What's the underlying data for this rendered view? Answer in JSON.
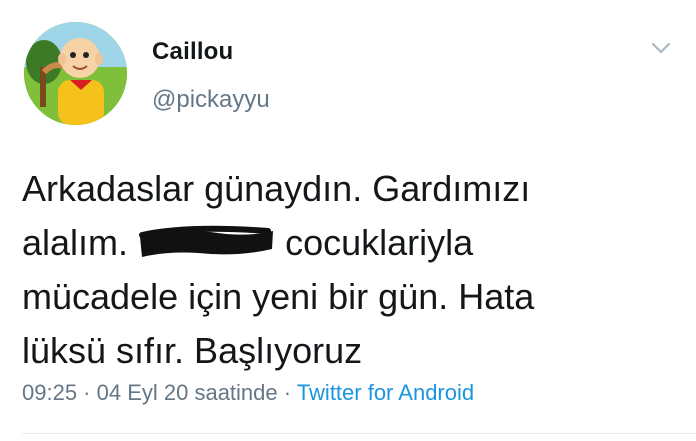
{
  "tweet": {
    "display_name": "Caillou",
    "handle": "@pickayyu",
    "text_lines": [
      "Arkadaslar günaydın. Gardımızı",
      "cocuklariyla",
      "mücadele için yeni bir gün. Hata",
      "lüksü sıfır. Başlıyoruz"
    ],
    "line2_prefix": "alalım.",
    "time": "09:25",
    "separator": " · ",
    "date": "04 Eyl 20 saatinde",
    "source": "Twitter for Android"
  },
  "colors": {
    "text": "#14171a",
    "secondary": "#657786",
    "link": "#1b95e0",
    "redaction": "#111111"
  },
  "icons": {
    "caret": "chevron-down-icon",
    "avatar": "cartoon-avatar"
  }
}
